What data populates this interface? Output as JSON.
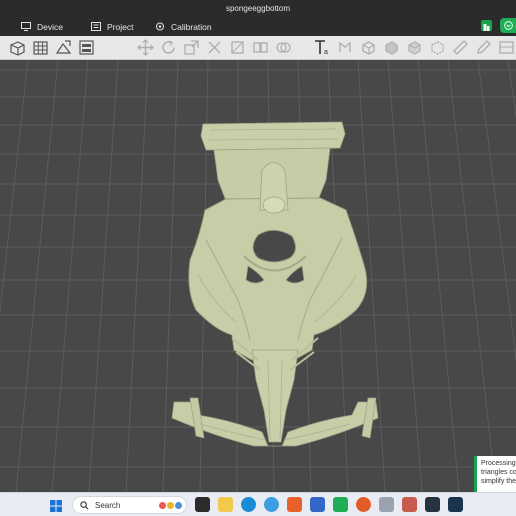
{
  "window": {
    "title": "spongeeggbottom"
  },
  "menu": {
    "device": "Device",
    "project": "Project",
    "calibration": "Calibration"
  },
  "toolbar": {
    "icons": [
      "add-object-icon",
      "grid-arrange-icon",
      "orient-icon",
      "layers-icon",
      "move-icon",
      "rotate-icon",
      "scale-icon",
      "cut-icon",
      "text-icon",
      "support-paint-icon",
      "seam-paint-icon",
      "color-paint-icon",
      "measure-icon",
      "assembly-icon"
    ]
  },
  "notification": {
    "lines": [
      "Processing o",
      "triangles co",
      "simplify the"
    ]
  },
  "taskbar": {
    "search_placeholder": "Search"
  },
  "colors": {
    "model": "#c7cfa9",
    "bed": "#474848",
    "grid": "#5a5b5b",
    "accent_green": "#1fae56"
  }
}
